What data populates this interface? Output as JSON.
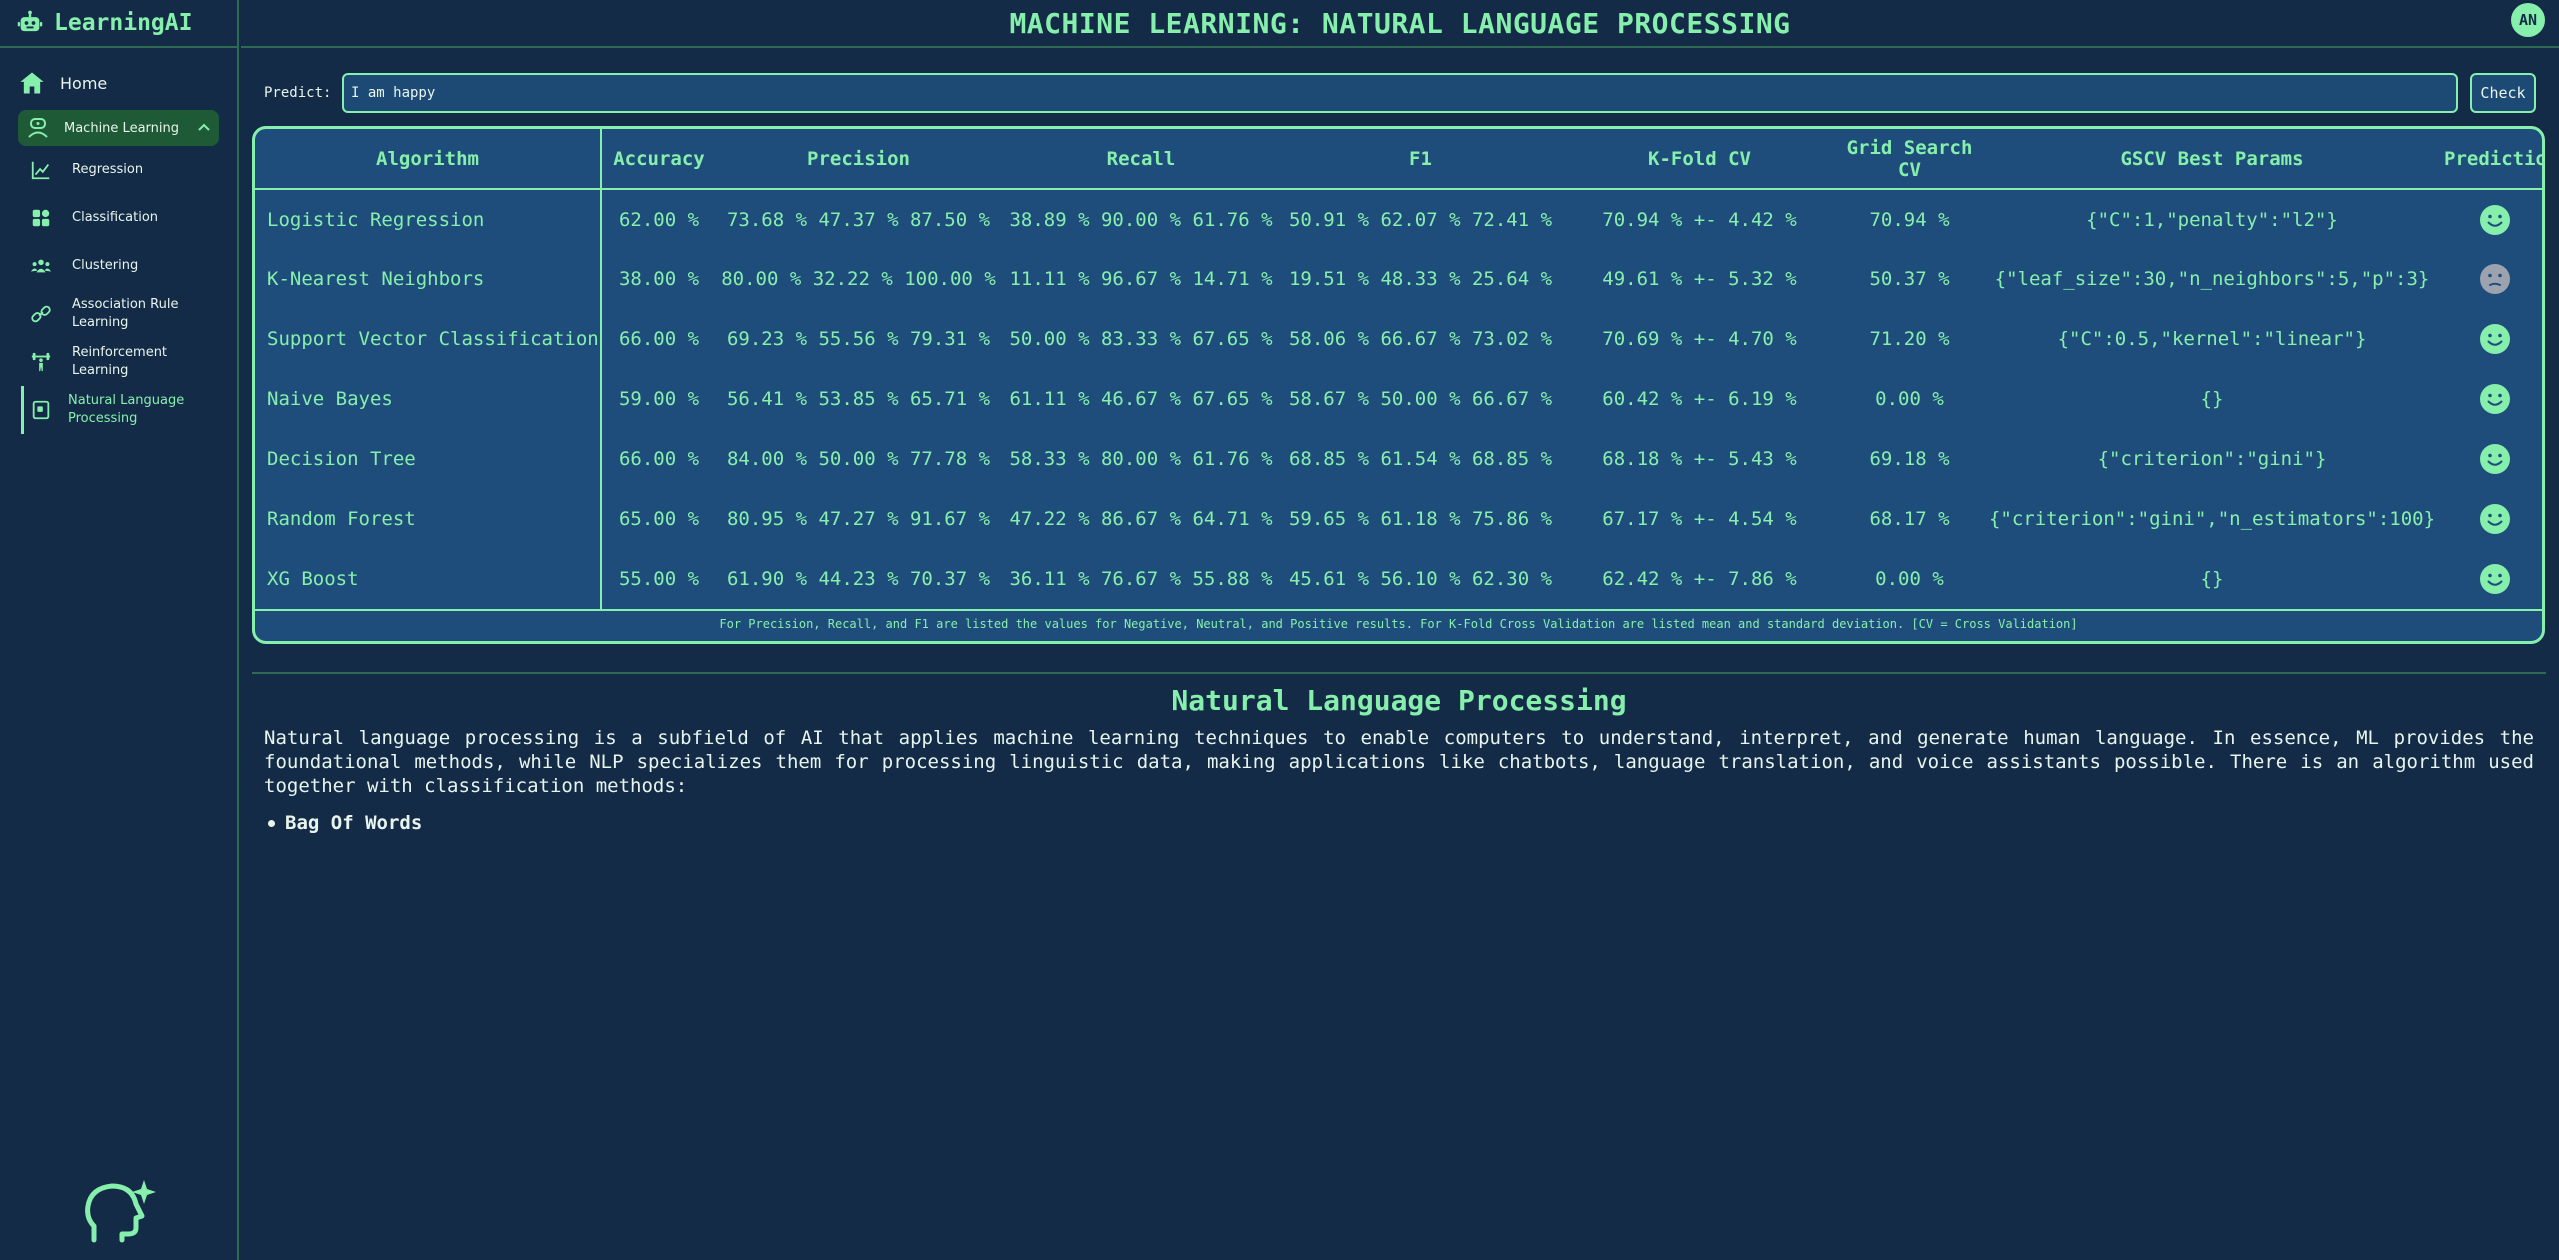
{
  "app": {
    "name": "LearningAI",
    "avatar_initials": "AN"
  },
  "header": {
    "title": "MACHINE LEARNING: NATURAL LANGUAGE PROCESSING"
  },
  "sidebar": {
    "home_label": "Home",
    "section_label": "Machine Learning",
    "items": [
      {
        "label": "Regression",
        "icon": "chart-line-icon"
      },
      {
        "label": "Classification",
        "icon": "grid-icon"
      },
      {
        "label": "Clustering",
        "icon": "users-icon"
      },
      {
        "label": "Association Rule Learning",
        "icon": "link-icon"
      },
      {
        "label": "Reinforcement Learning",
        "icon": "weightlifting-icon"
      },
      {
        "label": "Natural Language Processing",
        "icon": "book-icon",
        "active": true
      }
    ]
  },
  "predict": {
    "label": "Predict:",
    "value": "I am happy",
    "button_label": "Check"
  },
  "table": {
    "headers": [
      "Algorithm",
      "Accuracy",
      "Precision",
      "Recall",
      "F1",
      "K-Fold CV",
      "Grid Search CV",
      "GSCV Best Params",
      "Prediction"
    ],
    "rows": [
      {
        "algorithm": "Logistic Regression",
        "accuracy": "62.00 %",
        "precision": "73.68 % 47.37 % 87.50 %",
        "recall": "38.89 % 90.00 % 61.76 %",
        "f1": "50.91 % 62.07 % 72.41 %",
        "kfold": "70.94 % +- 4.42 %",
        "gscv": "70.94 %",
        "params": "{\"C\":1,\"penalty\":\"l2\"}",
        "prediction": "positive"
      },
      {
        "algorithm": "K-Nearest Neighbors",
        "accuracy": "38.00 %",
        "precision": "80.00 % 32.22 % 100.00 %",
        "recall": "11.11 % 96.67 % 14.71 %",
        "f1": "19.51 % 48.33 % 25.64 %",
        "kfold": "49.61 % +- 5.32 %",
        "gscv": "50.37 %",
        "params": "{\"leaf_size\":30,\"n_neighbors\":5,\"p\":3}",
        "prediction": "neutral"
      },
      {
        "algorithm": "Support Vector Classification",
        "accuracy": "66.00 %",
        "precision": "69.23 % 55.56 % 79.31 %",
        "recall": "50.00 % 83.33 % 67.65 %",
        "f1": "58.06 % 66.67 % 73.02 %",
        "kfold": "70.69 % +- 4.70 %",
        "gscv": "71.20 %",
        "params": "{\"C\":0.5,\"kernel\":\"linear\"}",
        "prediction": "positive"
      },
      {
        "algorithm": "Naive Bayes",
        "accuracy": "59.00 %",
        "precision": "56.41 % 53.85 % 65.71 %",
        "recall": "61.11 % 46.67 % 67.65 %",
        "f1": "58.67 % 50.00 % 66.67 %",
        "kfold": "60.42 % +- 6.19 %",
        "gscv": "0.00 %",
        "params": "{}",
        "prediction": "positive"
      },
      {
        "algorithm": "Decision Tree",
        "accuracy": "66.00 %",
        "precision": "84.00 % 50.00 % 77.78 %",
        "recall": "58.33 % 80.00 % 61.76 %",
        "f1": "68.85 % 61.54 % 68.85 %",
        "kfold": "68.18 % +- 5.43 %",
        "gscv": "69.18 %",
        "params": "{\"criterion\":\"gini\"}",
        "prediction": "positive"
      },
      {
        "algorithm": "Random Forest",
        "accuracy": "65.00 %",
        "precision": "80.95 % 47.27 % 91.67 %",
        "recall": "47.22 % 86.67 % 64.71 %",
        "f1": "59.65 % 61.18 % 75.86 %",
        "kfold": "67.17 % +- 4.54 %",
        "gscv": "68.17 %",
        "params": "{\"criterion\":\"gini\",\"n_estimators\":100}",
        "prediction": "positive"
      },
      {
        "algorithm": "XG Boost",
        "accuracy": "55.00 %",
        "precision": "61.90 % 44.23 % 70.37 %",
        "recall": "36.11 % 76.67 % 55.88 %",
        "f1": "45.61 % 56.10 % 62.30 %",
        "kfold": "62.42 % +- 7.86 %",
        "gscv": "0.00 %",
        "params": "{}",
        "prediction": "positive"
      }
    ],
    "footnote": "For Precision, Recall, and F1 are listed the values for Negative, Neutral, and Positive results. For K-Fold Cross Validation are listed mean and standard deviation. [CV = Cross Validation]"
  },
  "section": {
    "title": "Natural Language Processing",
    "text": "Natural language processing is a subfield of AI that applies machine learning techniques to enable computers to understand, interpret, and generate human language. In essence, ML provides the foundational methods, while NLP specializes them for processing linguistic data, making applications like chatbots, language translation, and voice assistants possible. There is an algorithm used together with classification methods:",
    "methods": [
      "Bag Of Words"
    ]
  },
  "colors": {
    "accent": "#86efac",
    "background": "#132b47",
    "table_bg": "#1e4d7b",
    "neutral_face": "#9ca3af"
  }
}
